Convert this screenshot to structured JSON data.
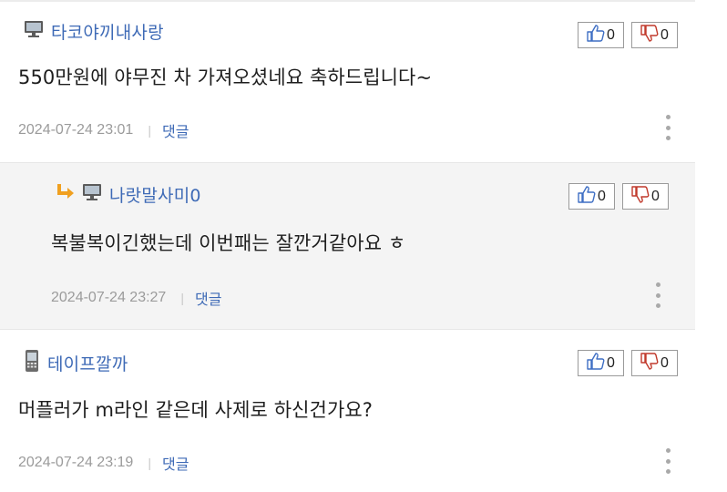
{
  "comments": [
    {
      "nickname": "타코야끼내사랑",
      "device": "pc-monitor-icon",
      "text": "550만원에 야무진 차 가져오셨네요 축하드립니다~",
      "timestamp": "2024-07-24 23:01",
      "reply_label": "댓글",
      "likes": "0",
      "dislikes": "0"
    },
    {
      "nickname": "나랏말사미0",
      "device": "pc-monitor-icon",
      "is_reply": true,
      "text": "복불복이긴했는데 이번패는 잘깐거같아요 ㅎ",
      "timestamp": "2024-07-24 23:27",
      "reply_label": "댓글",
      "likes": "0",
      "dislikes": "0"
    },
    {
      "nickname": "테이프깔까",
      "device": "mobile-phone-icon",
      "text": "머플러가 m라인 같은데 사제로 하신건가요?",
      "timestamp": "2024-07-24 23:19",
      "reply_label": "댓글",
      "likes": "0",
      "dislikes": "0"
    }
  ],
  "colors": {
    "nickname": "#3e6ab6",
    "reply_background": "#f4f4f4",
    "meta_text": "#9b9b9b",
    "like_icon": "#3f6fc4",
    "dislike_icon": "#c0392b",
    "reply_arrow": "#f0a020"
  }
}
